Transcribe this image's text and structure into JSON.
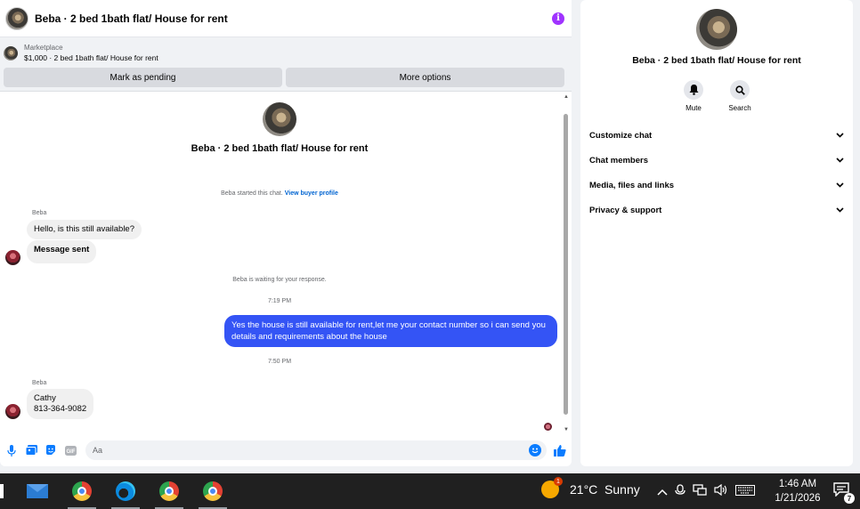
{
  "header": {
    "title": "Beba · 2 bed 1bath flat/ House for rent",
    "info_icon": "i"
  },
  "marketplace": {
    "label": "Marketplace",
    "listing": "$1,000 · 2 bed 1bath flat/ House for rent",
    "mark_pending": "Mark as pending",
    "more_options": "More options"
  },
  "conversation": {
    "title": "Beba · 2 bed 1bath flat/ House for rent",
    "started_text": "Beba started this chat.",
    "view_profile": "View buyer profile",
    "sender1": "Beba",
    "msg1": "Hello, is this still available?",
    "msg2": "Message sent",
    "waiting": "Beba is waiting for your response.",
    "time1": "7:19 PM",
    "reply": "Yes the house is still available for rent,let me your contact number so i can send you details and requirements about the house",
    "time2": "7:50 PM",
    "sender2": "Beba",
    "msg3_line1": "Cathy",
    "msg3_line2": "813-364-9082"
  },
  "composer": {
    "placeholder": "Aa"
  },
  "side": {
    "title": "Beba · 2 bed 1bath flat/ House for rent",
    "mute": "Mute",
    "search": "Search",
    "sections": [
      "Customize chat",
      "Chat members",
      "Media, files and links",
      "Privacy & support"
    ]
  },
  "taskbar": {
    "weather": "21°C  Sunny",
    "weather_badge": "1",
    "time": "1:46 AM",
    "date": "1/21/2026",
    "notif_count": "7"
  },
  "colors": {
    "accent": "#3454f5",
    "link": "#0064d1",
    "info": "#a033ff"
  }
}
